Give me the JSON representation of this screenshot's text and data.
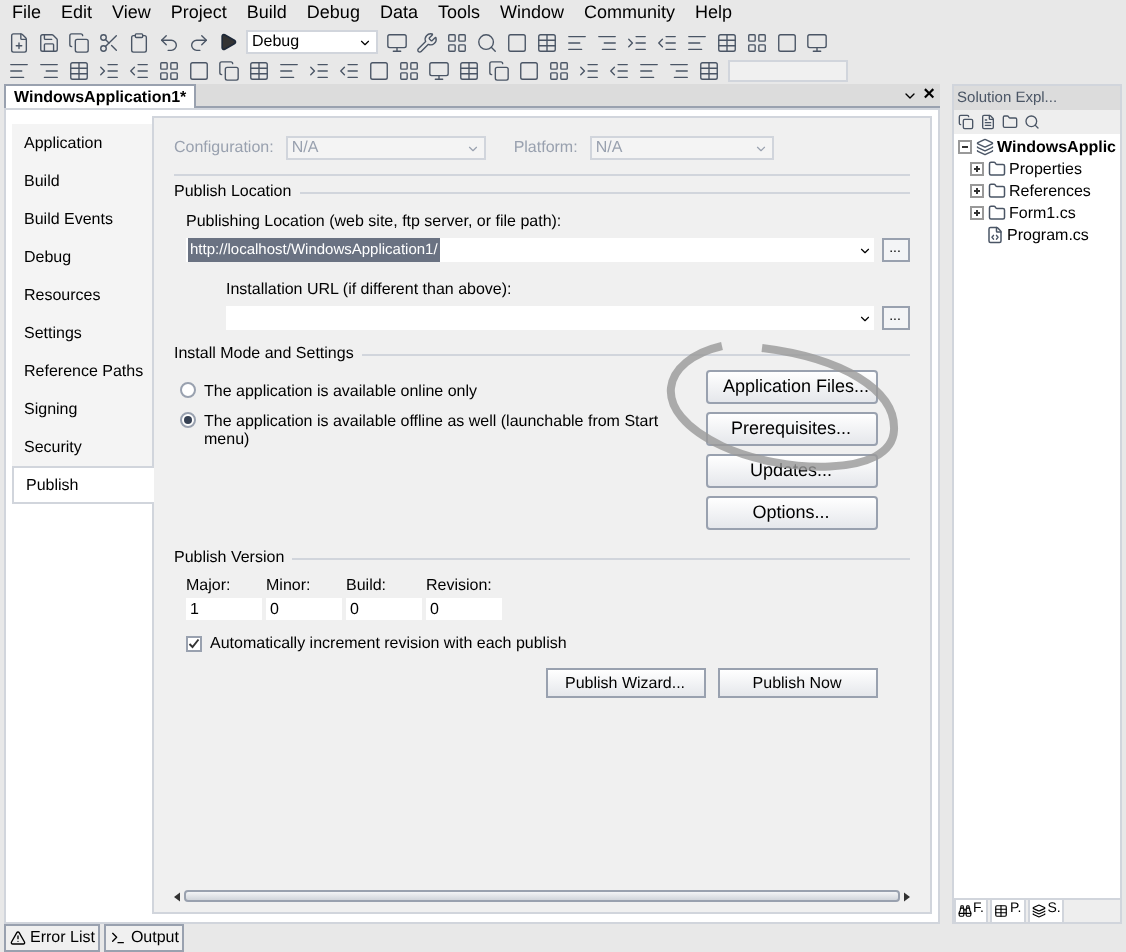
{
  "menu": [
    "File",
    "Edit",
    "View",
    "Project",
    "Build",
    "Debug",
    "Data",
    "Tools",
    "Window",
    "Community",
    "Help"
  ],
  "toolbar": {
    "config": "Debug"
  },
  "document_tab": {
    "title": "WindowsApplication1*",
    "close": "×"
  },
  "sidebar": [
    {
      "label": "Application",
      "selected": false
    },
    {
      "label": "Build",
      "selected": false
    },
    {
      "label": "Build Events",
      "selected": false
    },
    {
      "label": "Debug",
      "selected": false
    },
    {
      "label": "Resources",
      "selected": false
    },
    {
      "label": "Settings",
      "selected": false
    },
    {
      "label": "Reference Paths",
      "selected": false
    },
    {
      "label": "Signing",
      "selected": false
    },
    {
      "label": "Security",
      "selected": false
    },
    {
      "label": "Publish",
      "selected": true
    }
  ],
  "config": {
    "configuration_label": "Configuration:",
    "configuration_value": "N/A",
    "platform_label": "Platform:",
    "platform_value": "N/A",
    "disabled": true
  },
  "publish_location": {
    "heading": "Publish Location",
    "location_label": "Publishing Location (web site, ftp server, or file path):",
    "location_value": "http://localhost/WindowsApplication1/",
    "url_label": "Installation URL (if different than above):",
    "browse": "..."
  },
  "install_mode": {
    "heading": "Install Mode and Settings",
    "options": [
      {
        "label": "The application is available online only",
        "selected": false
      },
      {
        "label": "The application is available offline as well (launchable from Start menu)",
        "selected": true
      }
    ],
    "buttons": [
      "Application Files...",
      "Prerequisites...",
      "Updates...",
      "Options..."
    ]
  },
  "publish_version": {
    "heading": "Publish Version",
    "fields": [
      {
        "label": "Major:",
        "value": "1"
      },
      {
        "label": "Minor:",
        "value": "0"
      },
      {
        "label": "Build:",
        "value": "0"
      },
      {
        "label": "Revision:",
        "value": "0"
      }
    ],
    "auto_increment": {
      "label": "Automatically increment revision with each publish",
      "checked": true
    }
  },
  "actions": [
    "Publish Wizard...",
    "Publish Now"
  ],
  "solution_explorer": {
    "title": "Solution Expl...",
    "tree": [
      {
        "label": "WindowsApplic",
        "expanded": true,
        "children": [
          {
            "label": "Properties",
            "expanded": false
          },
          {
            "label": "References",
            "expanded": false
          },
          {
            "label": "Form1.cs",
            "expanded": false
          },
          {
            "label": "Program.cs"
          }
        ]
      }
    ],
    "bottom_tabs": [
      "F.",
      "P.",
      "S."
    ]
  },
  "bottom_panels": [
    "Error List",
    "Output"
  ]
}
